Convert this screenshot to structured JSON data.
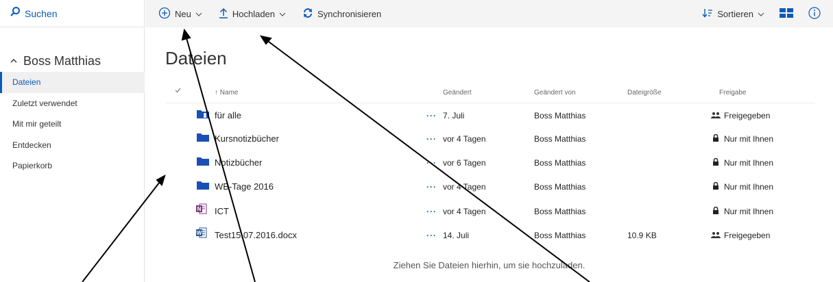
{
  "sidebar": {
    "search_label": "Suchen",
    "owner_name": "Boss Matthias",
    "items": [
      {
        "label": "Dateien",
        "active": true
      },
      {
        "label": "Zuletzt verwendet"
      },
      {
        "label": "Mit mir geteilt"
      },
      {
        "label": "Entdecken"
      },
      {
        "label": "Papierkorb"
      }
    ]
  },
  "toolbar": {
    "new_label": "Neu",
    "upload_label": "Hochladen",
    "sync_label": "Synchronisieren",
    "sort_label": "Sortieren"
  },
  "main": {
    "title": "Dateien",
    "columns": {
      "name": "Name",
      "modified": "Geändert",
      "modified_by": "Geändert von",
      "size": "Dateigröße",
      "sharing": "Freigabe"
    },
    "rows": [
      {
        "icon": "shared-folder-icon",
        "name": "für alle",
        "modified": "7. Juli",
        "modified_by": "Boss Matthias",
        "size": "",
        "sharing": "Freigegeben",
        "sharing_icon": "people-icon"
      },
      {
        "icon": "folder-icon",
        "name": "Kursnotizbücher",
        "modified": "vor 4 Tagen",
        "modified_by": "Boss Matthias",
        "size": "",
        "sharing": "Nur mit Ihnen",
        "sharing_icon": "lock-icon"
      },
      {
        "icon": "folder-icon",
        "name": "Notizbücher",
        "modified": "vor 6 Tagen",
        "modified_by": "Boss Matthias",
        "size": "",
        "sharing": "Nur mit Ihnen",
        "sharing_icon": "lock-icon"
      },
      {
        "icon": "folder-icon",
        "name": "WB-Tage 2016",
        "modified": "vor 4 Tagen",
        "modified_by": "Boss Matthias",
        "size": "",
        "sharing": "Nur mit Ihnen",
        "sharing_icon": "lock-icon"
      },
      {
        "icon": "onenote-icon",
        "name": "ICT",
        "modified": "vor 4 Tagen",
        "modified_by": "Boss Matthias",
        "size": "",
        "sharing": "Nur mit Ihnen",
        "sharing_icon": "lock-icon"
      },
      {
        "icon": "word-doc-icon",
        "name": "Test15.07.2016.docx",
        "modified": "14. Juli",
        "modified_by": "Boss Matthias",
        "size": "10.9 KB",
        "sharing": "Freigegeben",
        "sharing_icon": "people-icon"
      }
    ],
    "row_menu_glyph": "···",
    "drop_hint": "Ziehen Sie Dateien hierhin, um sie hochzuladen."
  },
  "colors": {
    "accent": "#0a5bb5",
    "folder": "#1b4fb8",
    "toolbar_bg": "#f4f4f4"
  }
}
